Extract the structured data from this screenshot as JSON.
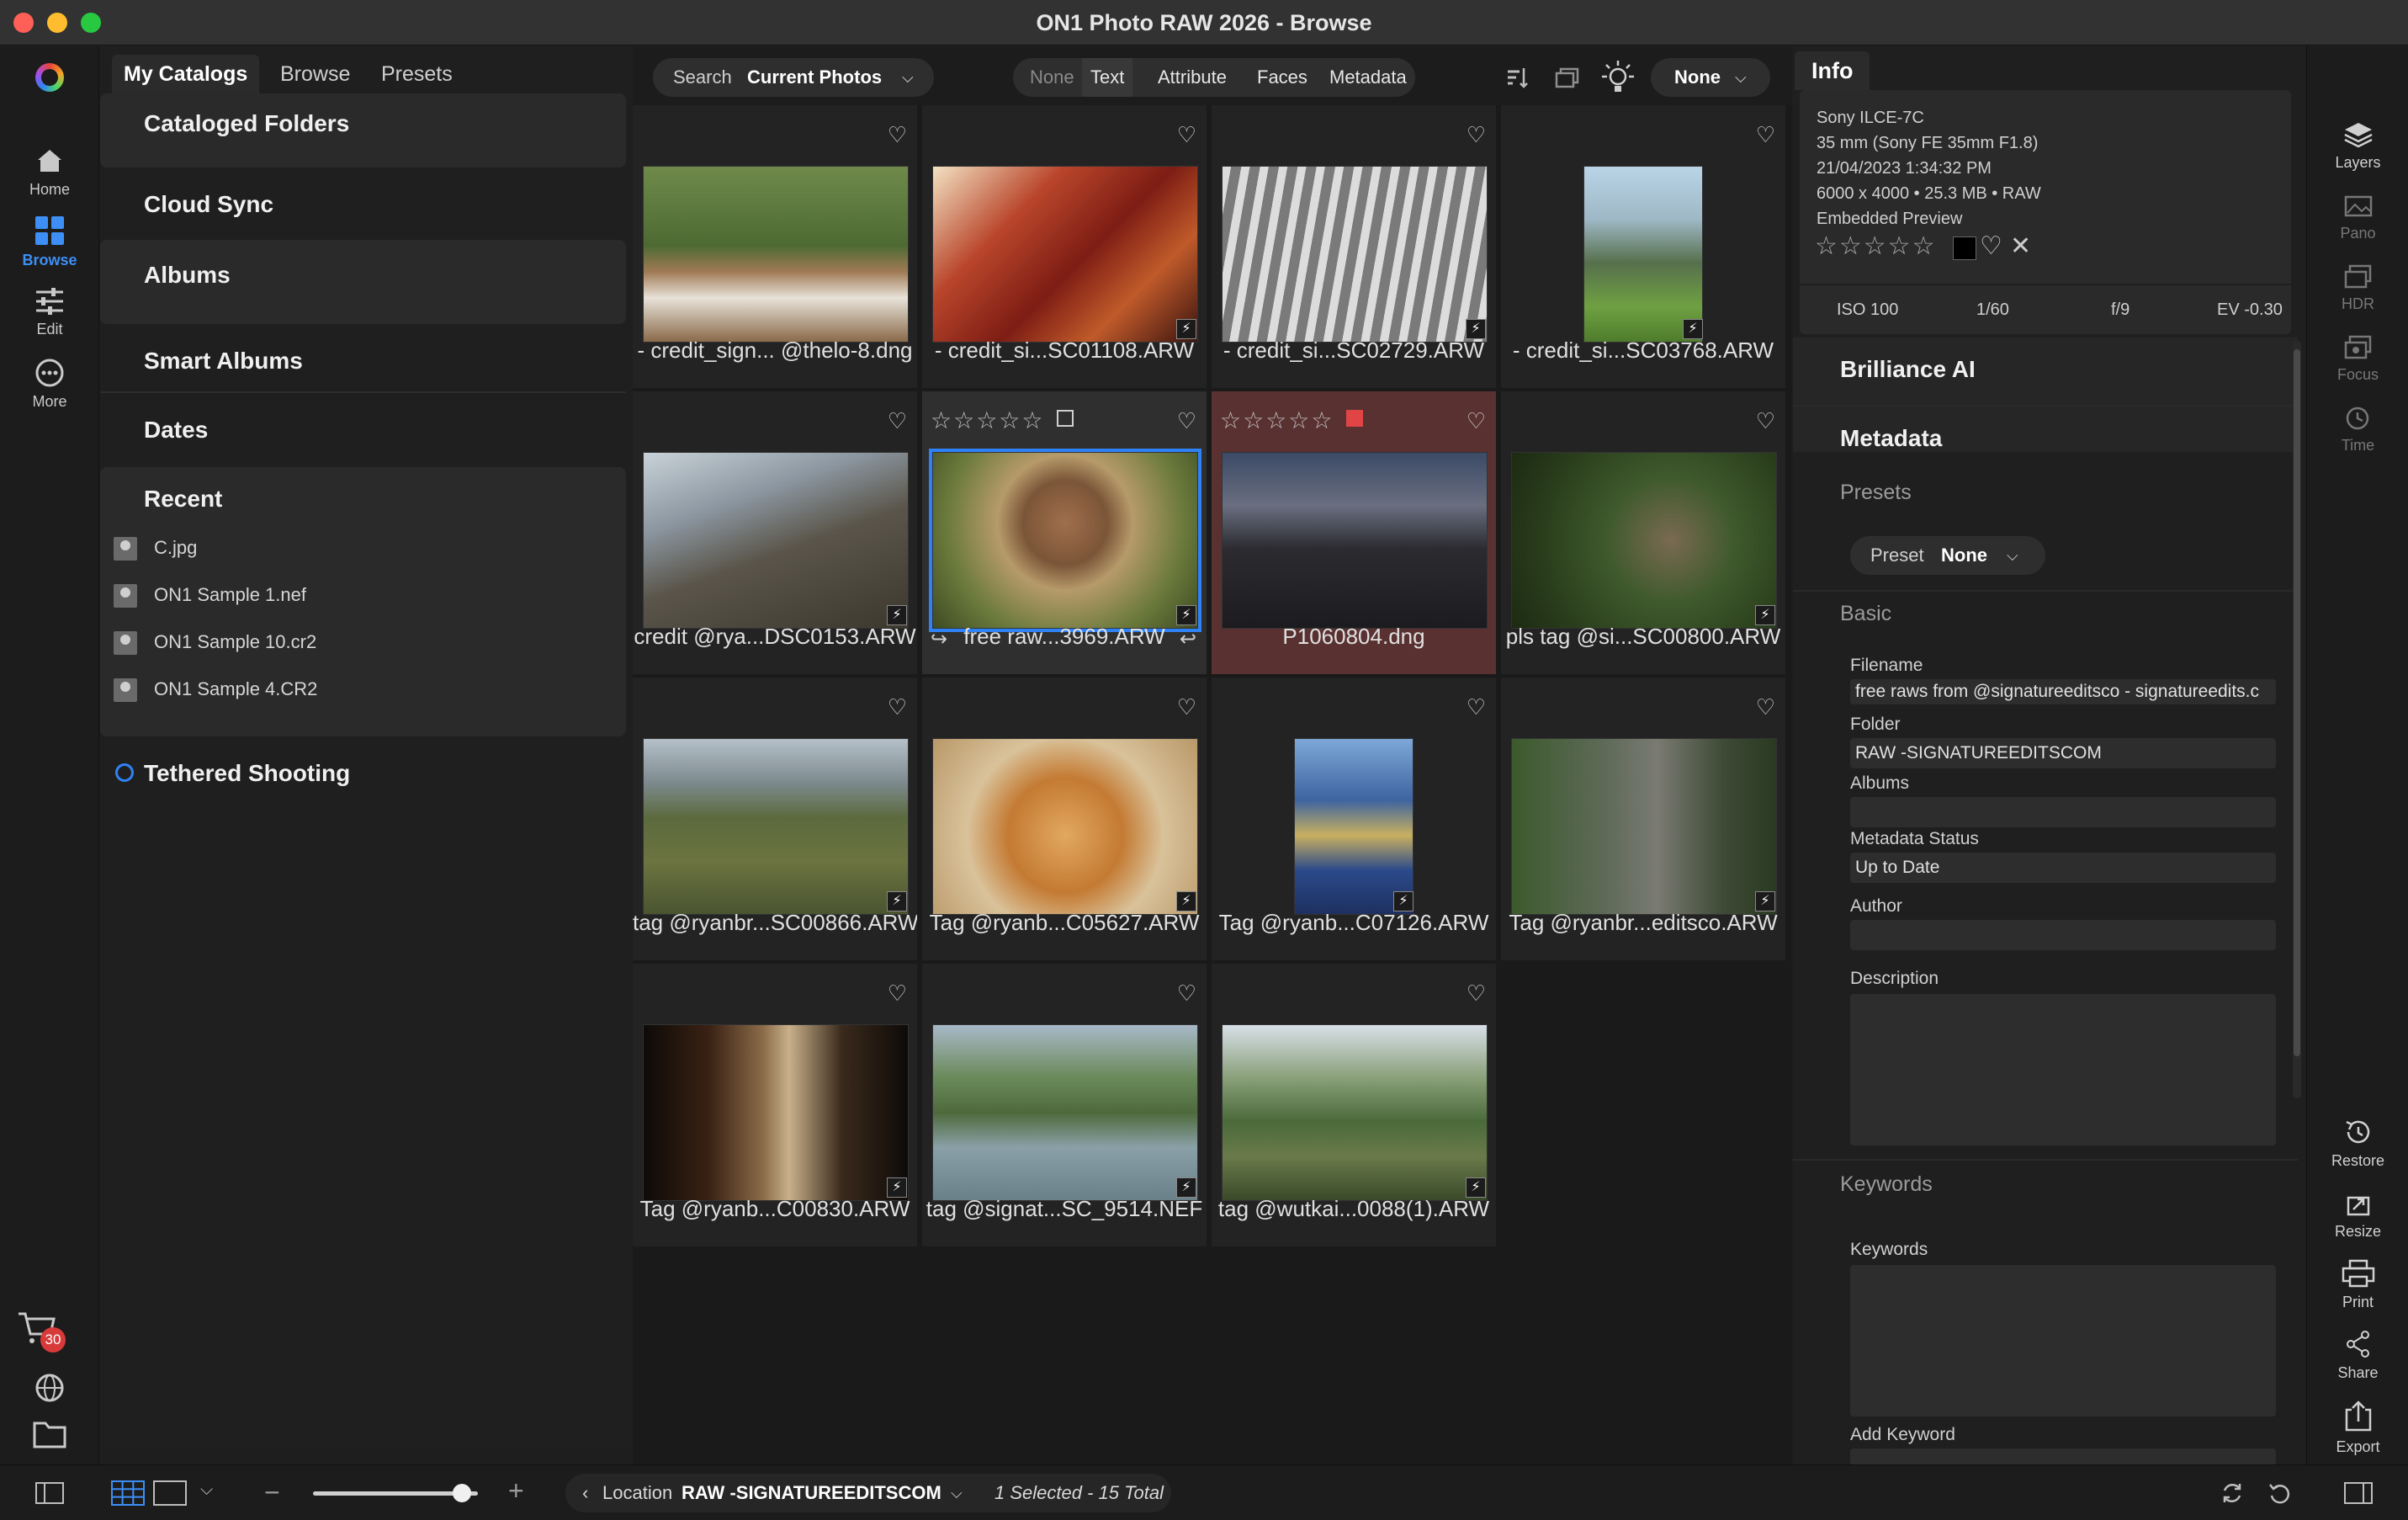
{
  "window": {
    "title": "ON1 Photo RAW 2026 - Browse"
  },
  "left_rail": {
    "items": [
      {
        "label": "Home",
        "icon": "home-icon"
      },
      {
        "label": "Browse",
        "icon": "browse-icon",
        "active": true
      },
      {
        "label": "Edit",
        "icon": "sliders-icon"
      },
      {
        "label": "More",
        "icon": "more-icon"
      }
    ],
    "cart_badge": "30"
  },
  "left_panel": {
    "tabs": [
      "My Catalogs",
      "Browse",
      "Presets"
    ],
    "sections": {
      "cataloged_folders": "Cataloged Folders",
      "cloud_sync": "Cloud Sync",
      "albums": "Albums",
      "smart_albums": "Smart Albums",
      "dates": "Dates",
      "recent": "Recent",
      "tethered": "Tethered Shooting"
    },
    "recent_items": [
      "C.jpg",
      "ON1 Sample 1.nef",
      "ON1 Sample 10.cr2",
      "ON1 Sample 4.CR2"
    ]
  },
  "toolbar": {
    "search_label": "Search",
    "search_scope": "Current Photos",
    "filters": [
      "None",
      "Text",
      "Attribute",
      "Faces",
      "Metadata"
    ],
    "sort_value": "None"
  },
  "grid": {
    "photos": [
      {
        "name": "- credit_sign... @thelo-8.dng"
      },
      {
        "name": "- credit_si...SC01108.ARW"
      },
      {
        "name": "- credit_si...SC02729.ARW"
      },
      {
        "name": "- credit_si...SC03768.ARW"
      },
      {
        "name": "credit @rya...DSC0153.ARW"
      },
      {
        "name": "free raw...3969.ARW"
      },
      {
        "name": "P1060804.dng"
      },
      {
        "name": "pls tag @si...SC00800.ARW"
      },
      {
        "name": "tag @ryanbr...SC00866.ARW"
      },
      {
        "name": "Tag @ryanb...C05627.ARW"
      },
      {
        "name": "Tag @ryanb...C07126.ARW"
      },
      {
        "name": "Tag @ryanbr...editsco.ARW"
      },
      {
        "name": "Tag @ryanb...C00830.ARW"
      },
      {
        "name": "tag @signat...SC_9514.NEF"
      },
      {
        "name": "tag @wutkai...0088(1).ARW"
      }
    ],
    "star_glyphs": "☆☆☆☆☆"
  },
  "info_panel": {
    "tab": "Info",
    "camera": "Sony ILCE-7C",
    "lens": "35 mm (Sony FE 35mm F1.8)",
    "date": "21/04/2023 1:34:32 PM",
    "dimensions": "6000 x 4000 • 25.3 MB • RAW",
    "preview": "Embedded Preview",
    "iso": "ISO 100",
    "shutter": "1/60",
    "aperture": "f/9",
    "ev": "EV -0.30"
  },
  "right_panel": {
    "brilliance": "Brilliance AI",
    "metadata": "Metadata",
    "presets_label": "Presets",
    "preset_prefix": "Preset",
    "preset_value": "None",
    "basic_label": "Basic",
    "fields": {
      "filename_label": "Filename",
      "filename_value": "free raws from @signatureeditsco - signatureedits.c",
      "folder_label": "Folder",
      "folder_value": "RAW -SIGNATUREEDITSCOM",
      "albums_label": "Albums",
      "albums_value": "",
      "status_label": "Metadata Status",
      "status_value": "Up to Date",
      "author_label": "Author",
      "author_value": "",
      "description_label": "Description"
    },
    "keywords_section": "Keywords",
    "keywords_label": "Keywords",
    "add_keyword_label": "Add Keyword"
  },
  "right_rail": {
    "items": [
      "Layers",
      "Pano",
      "HDR",
      "Focus",
      "Time",
      "Restore",
      "Resize",
      "Print",
      "Share",
      "Export"
    ]
  },
  "bottom_bar": {
    "location_label": "Location",
    "location_value": "RAW -SIGNATUREEDITSCOM",
    "selection": "1 Selected - 15 Total"
  },
  "colors": {
    "accent": "#2f82f5",
    "red_label": "#e04444",
    "cart_badge": "#d83a3a"
  }
}
